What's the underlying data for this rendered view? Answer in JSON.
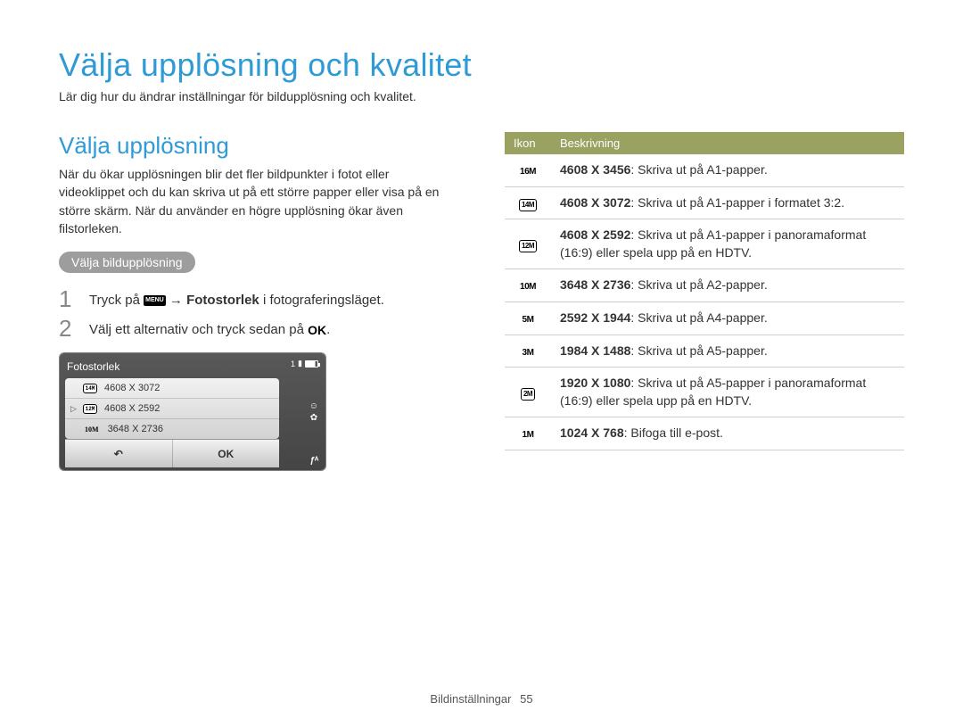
{
  "page": {
    "title": "Välja upplösning och kvalitet",
    "description": "Lär dig hur du ändrar inställningar för bildupplösning och kvalitet."
  },
  "section": {
    "title": "Välja upplösning",
    "description": "När du ökar upplösningen blir det fler bildpunkter i fotot eller videoklippet och du kan skriva ut på ett större papper eller visa på en större skärm. När du använder en högre upplösning ökar även filstorleken."
  },
  "pill": "Välja bildupplösning",
  "steps": {
    "s1_pre": "Tryck på ",
    "s1_menu": "MENU",
    "s1_arrow": " → ",
    "s1_bold": "Fotostorlek",
    "s1_post": " i fotograferingsläget.",
    "s2_pre": "Välj ett alternativ och tryck sedan på ",
    "s2_ok": "OK",
    "s2_post": "."
  },
  "camera": {
    "title": "Fotostorlek",
    "count": "1",
    "rows": [
      {
        "icon": "14M",
        "label": "4608 X 3072",
        "box": true
      },
      {
        "icon": "12M",
        "label": "4608 X 2592",
        "box": true,
        "selected": true
      },
      {
        "icon": "10M",
        "label": "3648 X 2736",
        "box": false
      }
    ],
    "back": "↶",
    "ok": "OK",
    "flash": "ƒᴬ"
  },
  "table": {
    "header_icon": "Ikon",
    "header_desc": "Beskrivning",
    "rows": [
      {
        "icon": "16M",
        "box": false,
        "bold": "4608 X 3456",
        "text": ": Skriva ut på A1-papper."
      },
      {
        "icon": "14M",
        "box": true,
        "bold": "4608 X 3072",
        "text": ": Skriva ut på A1-papper i formatet 3:2."
      },
      {
        "icon": "12M",
        "box": true,
        "bold": "4608 X 2592",
        "text": ": Skriva ut på A1-papper i panoramaformat (16:9) eller spela upp på en HDTV."
      },
      {
        "icon": "10M",
        "box": false,
        "bold": "3648 X 2736",
        "text": ": Skriva ut på A2-papper."
      },
      {
        "icon": "5M",
        "box": false,
        "bold": "2592 X 1944",
        "text": ": Skriva ut på A4-papper."
      },
      {
        "icon": "3M",
        "box": false,
        "bold": "1984 X 1488",
        "text": ": Skriva ut på A5-papper."
      },
      {
        "icon": "2M",
        "box": true,
        "bold": "1920 X 1080",
        "text": ": Skriva ut på A5-papper i panoramaformat (16:9) eller spela upp på en HDTV."
      },
      {
        "icon": "1M",
        "box": false,
        "bold": "1024 X 768",
        "text": ": Bifoga till e-post."
      }
    ]
  },
  "footer": {
    "section": "Bildinställningar",
    "page": "55"
  }
}
